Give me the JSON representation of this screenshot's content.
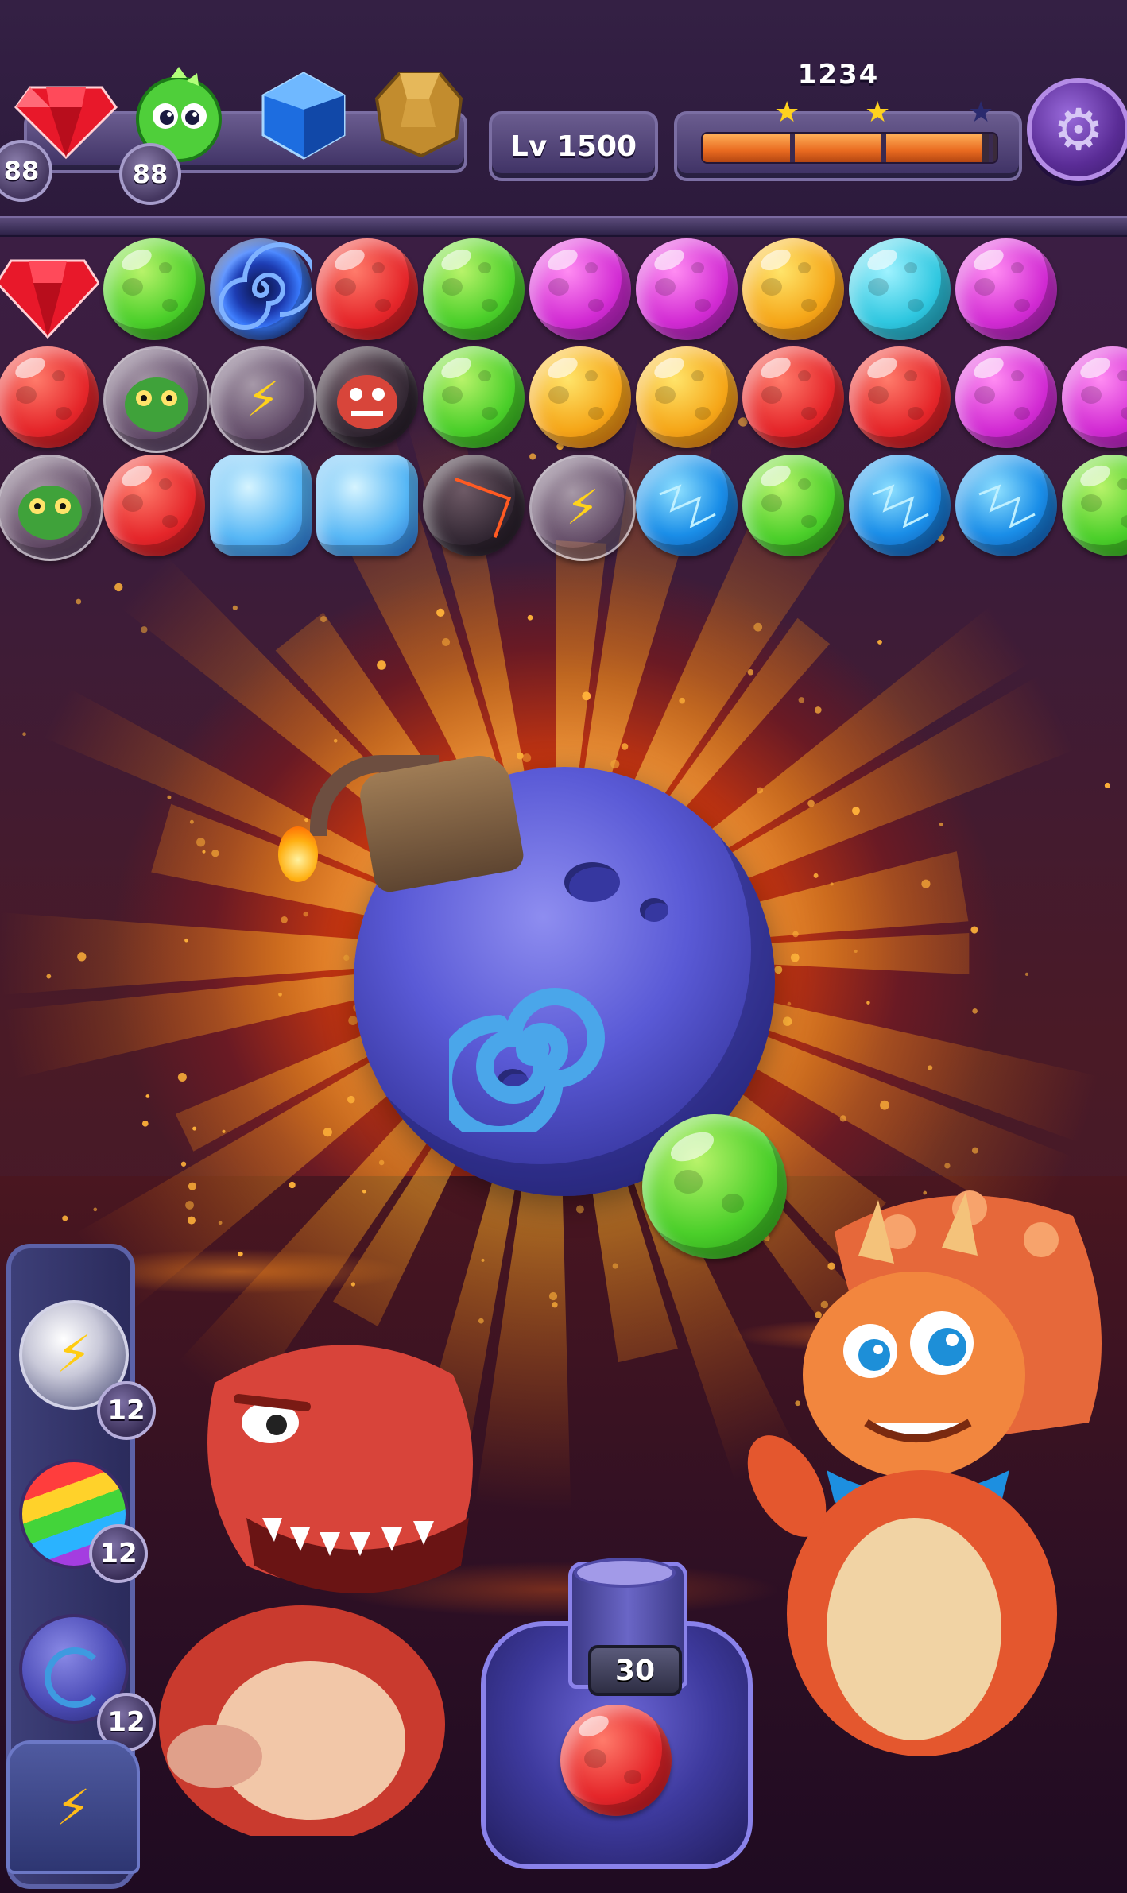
{
  "hud": {
    "resources": [
      {
        "name": "ruby-gem-icon",
        "count": "88"
      },
      {
        "name": "green-dino-icon",
        "count": "88"
      },
      {
        "name": "blue-sapphire-icon"
      },
      {
        "name": "gold-nugget-icon"
      }
    ],
    "level_label": "Lv 1500",
    "score": "1234",
    "progress": 0.95,
    "stars_earned": 2,
    "stars_total": 3
  },
  "bubble_grid": {
    "rows": [
      [
        "ruby-gem",
        "green",
        "vortex",
        "red",
        "green",
        "purple",
        "purple",
        "yellow",
        "cyan",
        "purple"
      ],
      [
        "red",
        "dragon-bubble",
        "lightning-bubble",
        "caged-red-dragon",
        "green",
        "yellow",
        "yellow",
        "red",
        "red",
        "purple",
        "purple"
      ],
      [
        "chameleon-bubble",
        "red",
        "ice",
        "ice",
        "lava-rock",
        "lightning-bubble",
        "electric",
        "green",
        "electric",
        "electric",
        "green"
      ]
    ]
  },
  "effect": {
    "bomb": "spiral-bomb-icon",
    "flying_bubble": "green"
  },
  "boosters": [
    {
      "name": "lightning-booster",
      "count": "12"
    },
    {
      "name": "rainbow-booster",
      "count": "12"
    },
    {
      "name": "bomb-booster",
      "count": "12"
    }
  ],
  "shooter": {
    "ammo": "30",
    "loaded_bubble": "red"
  },
  "characters": [
    "red-trex",
    "orange-triceratops"
  ],
  "colors": {
    "red": "#e5262a",
    "green": "#4bcf2a",
    "purple": "#d22bd3",
    "yellow": "#f5a618",
    "cyan": "#2fc7e0",
    "accent": "#7b6ea3"
  }
}
